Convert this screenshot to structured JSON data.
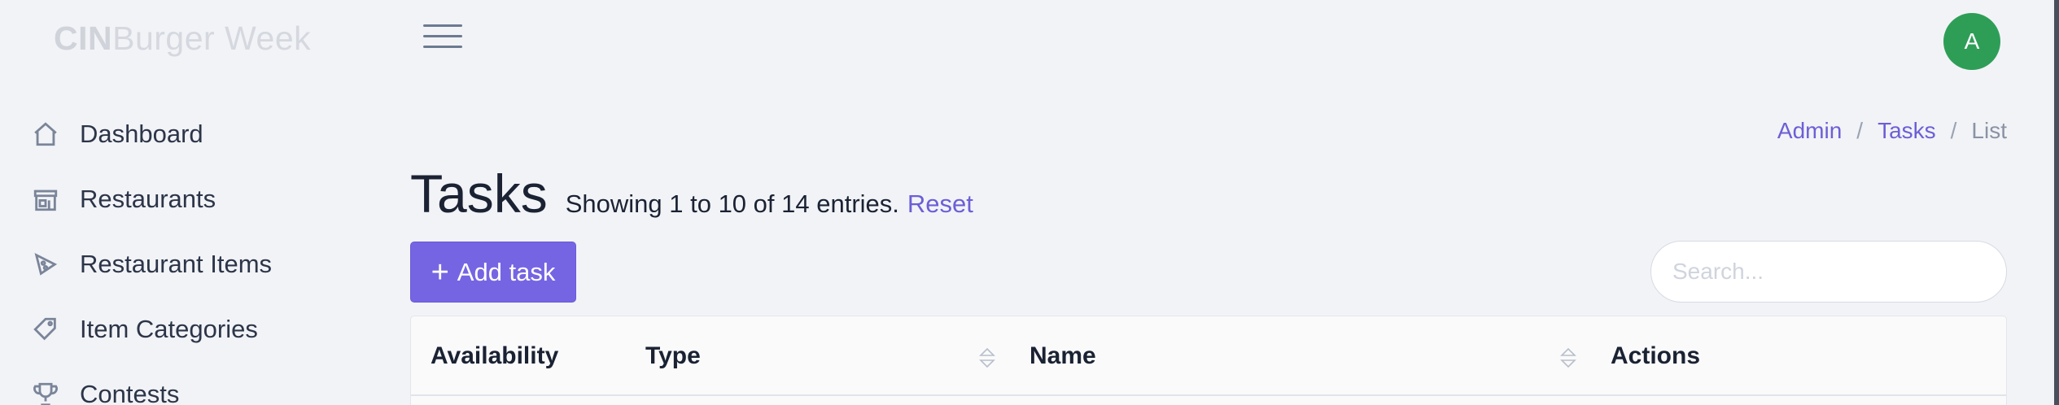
{
  "brand": {
    "bold": "CIN",
    "rest": "Burger Week"
  },
  "sidebar": {
    "items": [
      {
        "label": "Dashboard",
        "icon": "home-icon"
      },
      {
        "label": "Restaurants",
        "icon": "store-icon"
      },
      {
        "label": "Restaurant Items",
        "icon": "pizza-icon"
      },
      {
        "label": "Item Categories",
        "icon": "tag-icon"
      },
      {
        "label": "Contests",
        "icon": "trophy-icon"
      }
    ]
  },
  "header": {
    "avatar_initial": "A"
  },
  "breadcrumb": {
    "items": [
      "Admin",
      "Tasks"
    ],
    "current": "List",
    "separator": "/"
  },
  "page": {
    "title": "Tasks",
    "entries_text": "Showing 1 to 10 of 14 entries.",
    "reset_label": "Reset"
  },
  "toolbar": {
    "add_label": "Add task",
    "add_icon": "+",
    "search_placeholder": "Search..."
  },
  "table": {
    "columns": [
      {
        "label": "Availability",
        "sortable": false
      },
      {
        "label": "Type",
        "sortable": true
      },
      {
        "label": "Name",
        "sortable": true
      },
      {
        "label": "Actions",
        "sortable": false
      }
    ]
  },
  "colors": {
    "accent": "#7565e3",
    "avatar": "#2e9e57",
    "link": "#6c5fd6"
  }
}
